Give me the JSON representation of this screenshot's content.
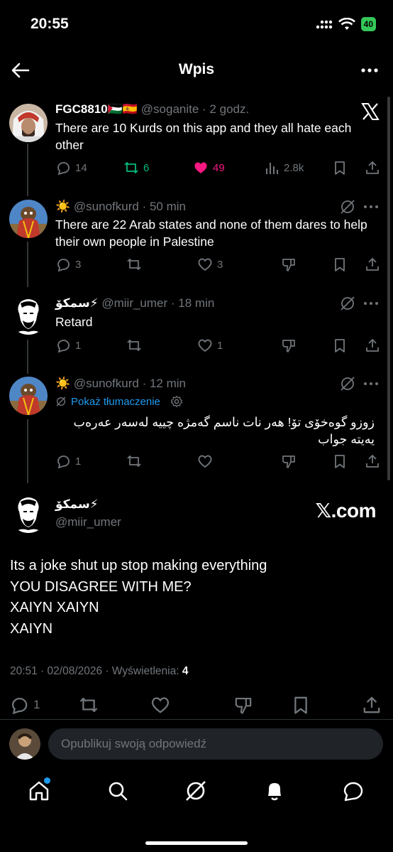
{
  "status": {
    "time": "20:55",
    "battery": "40"
  },
  "topbar": {
    "title": "Wpis"
  },
  "posts": [
    {
      "name": "FGC8810🇵🇸🇪🇸",
      "handle": "@soganite",
      "time": "· 2 godz.",
      "text": "There are 10 Kurds on this app and they all hate each other",
      "replies": "14",
      "reposts": "6",
      "likes": "49",
      "views": "2.8k"
    },
    {
      "name": "☀️",
      "handle": "@sunofkurd",
      "time": "· 50 min",
      "text": "There are 22 Arab states and none of them dares to help their own people in Palestine",
      "replies": "3",
      "likes": "3"
    },
    {
      "name": "سمکۆ⚡",
      "handle": "@miir_umer",
      "time": "· 18 min",
      "text": "Retard",
      "replies": "1",
      "likes": "1"
    },
    {
      "name": "☀️",
      "handle": "@sunofkurd",
      "time": "· 12 min",
      "translate": "Pokaż tłumaczenie",
      "text": "زوزو گوەخۆی تۆ! هەر نات ناسم گەمژە چییە لەسەر عەرەب یەیتە جواب",
      "replies": "1"
    }
  ],
  "main_post": {
    "name": "سمکۆ⚡",
    "handle": "@miir_umer",
    "watermark": "𝕏.com",
    "lines": [
      "Its a joke shut up stop making everything",
      "YOU DISAGREE WITH ME?",
      "XAIYN XAIYN",
      "XAIYN"
    ],
    "meta": "20:51 · 02/08/2026 · Wyświetlenia:",
    "views": "4",
    "replies": "1"
  },
  "reply": {
    "placeholder": "Opublikuj swoją odpowiedź"
  },
  "colors": {
    "like": "#f91880",
    "repost": "#00ba7c",
    "accent": "#1d9bf0"
  },
  "icons": [
    "back-arrow-icon",
    "more-icon",
    "x-logo-icon",
    "reply-icon",
    "repost-icon",
    "heart-icon",
    "views-icon",
    "bookmark-icon",
    "share-icon",
    "grok-icon",
    "downvote-icon",
    "home-icon",
    "search-icon",
    "grok-nav-icon",
    "bell-icon",
    "messages-icon"
  ]
}
